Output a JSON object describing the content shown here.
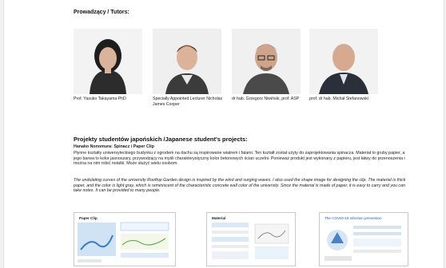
{
  "tutors": {
    "heading": "Prowadzący / Tutors:",
    "people": [
      {
        "name": "Prof. Yasuko Takayama PhD"
      },
      {
        "name": "Specially Appointed Lecturer Nicholas James Cooper"
      },
      {
        "name": "dr hab. Grzegorz Niwiński, prof. ASP"
      },
      {
        "name": "prof. dr hab. Michał Stefanowski"
      }
    ]
  },
  "projects": {
    "heading": "Projekty studentów japońskich /Japanese student's projects:",
    "project_title": "Hanako Nonomura: Spinacz / Paper Clip",
    "body_pl": "Płynne kształty uniwersyteckiego budynku z ogrodem na dachu są inspirowane wiatrem i falami. Ten kształt został użyty do zaprojektowania spinacza. Materiał to gruby papier, a jego barwa to kolor jasnoszary, przywodzący na myśli charakterystyczny kolor betonowych ścian uczelni. Ponieważ produkt jest wykonany z papieru, jest łatwy do przenoszenia i można na nim robić notatki. Może służyć wielu osobom.",
    "body_en": "The undulating curves of the university Rooftop Garden design is inspired by the wind and surging waves. I also used the shape image for designing the clip. The material is thick paper, and the color is light gray, which is reminiscent of the characteristic concrete wall color of the university. Since the material is made of paper, it is easy to carry and you can take notes. It can be provided to many people."
  },
  "thumbnails": [
    {
      "title": "Paper Clip"
    },
    {
      "title": "Material"
    },
    {
      "title": "The COVID-19 infection prevention"
    }
  ]
}
